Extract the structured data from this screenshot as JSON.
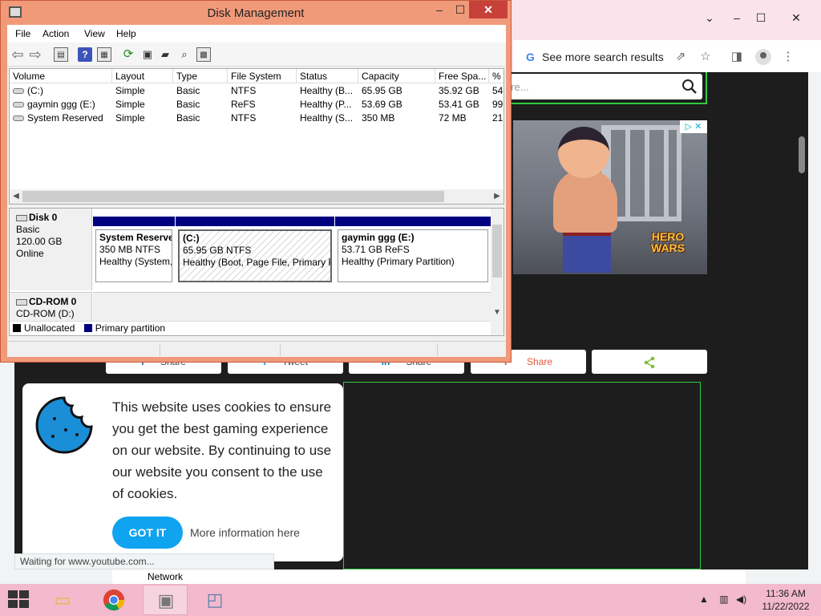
{
  "browser": {
    "omnibar": {
      "see_more": "See more search results",
      "g": "G"
    },
    "site_search_placeholder": "ere...",
    "ad": {
      "logo_line1": "HERO",
      "logo_line2": "WARS",
      "ad_badge": "▷ ✕"
    },
    "share_buttons": [
      {
        "icon": "f",
        "label": "Share"
      },
      {
        "icon": "t",
        "label": "Tweet"
      },
      {
        "icon": "in",
        "label": "Share"
      },
      {
        "icon": "P",
        "label": "Share"
      },
      {
        "icon": "share-icon",
        "label": ""
      }
    ],
    "cookie": {
      "text": "This website uses cookies to ensure you get the best gaming experience on our website. By continuing to use our website you consent to the use of cookies.",
      "got_it": "GOT IT",
      "more_info": "More information here"
    },
    "status": "Waiting for www.youtube.com...",
    "network_hint": "Network"
  },
  "disk_management": {
    "title": "Disk Management",
    "menu": [
      "File",
      "Action",
      "View",
      "Help"
    ],
    "columns": [
      "Volume",
      "Layout",
      "Type",
      "File System",
      "Status",
      "Capacity",
      "Free Spa...",
      "% F"
    ],
    "volumes": [
      {
        "volume": "(C:)",
        "layout": "Simple",
        "type": "Basic",
        "fs": "NTFS",
        "status": "Healthy (B...",
        "capacity": "65.95 GB",
        "free": "35.92 GB",
        "pct": "54"
      },
      {
        "volume": "gaymin ggg (E:)",
        "layout": "Simple",
        "type": "Basic",
        "fs": "ReFS",
        "status": "Healthy (P...",
        "capacity": "53.69 GB",
        "free": "53.41 GB",
        "pct": "99"
      },
      {
        "volume": "System Reserved",
        "layout": "Simple",
        "type": "Basic",
        "fs": "NTFS",
        "status": "Healthy (S...",
        "capacity": "350 MB",
        "free": "72 MB",
        "pct": "21"
      }
    ],
    "disk0": {
      "name": "Disk 0",
      "type": "Basic",
      "size": "120.00 GB",
      "state": "Online"
    },
    "partitions": [
      {
        "name": "System Reserve",
        "size": "350 MB NTFS",
        "status": "Healthy (System, "
      },
      {
        "name": "(C:)",
        "size": "65.95 GB NTFS",
        "status": "Healthy (Boot, Page File, Primary P"
      },
      {
        "name": "gaymin ggg  (E:)",
        "size": "53.71 GB ReFS",
        "status": "Healthy (Primary Partition)"
      }
    ],
    "cdrom": {
      "name": "CD-ROM 0",
      "sub": "CD-ROM (D:)"
    },
    "legend": {
      "unallocated": "Unallocated",
      "primary": "Primary partition"
    },
    "colors": {
      "primary": "#000080",
      "unallocated": "#000000",
      "titlebar": "#f19a7a"
    }
  },
  "taskbar": {
    "clock_time": "11:36 AM",
    "clock_date": "11/22/2022",
    "apps": [
      "file-explorer-icon",
      "chrome-icon",
      "disk-management-icon",
      "resource-monitor-icon"
    ]
  }
}
